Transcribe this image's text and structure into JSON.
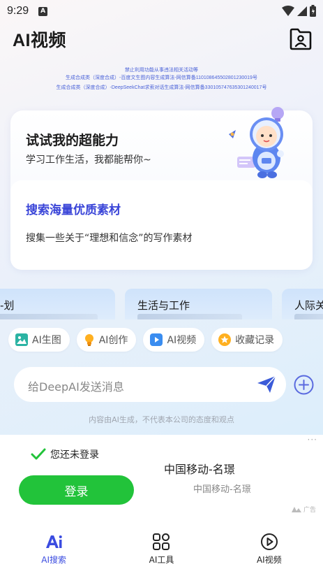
{
  "status_bar": {
    "time": "9:29",
    "notification_badge": "A"
  },
  "header": {
    "title": "AI视频"
  },
  "notices": [
    "禁止利用功能从事违法相关活动等",
    "生成合成类（深度合成）-百度文生图内容生成算法-网信算备110108645502801230019号",
    "生成合成类（深度合成）-DeepSeekChat求索对话生成算法-网信算备330105747635301240017号"
  ],
  "hero": {
    "title": "试试我的超能力",
    "subtitle": "学习工作生活，我都能帮你~"
  },
  "suggestion": {
    "title": "搜索海量优质素材",
    "text": "搜集一些关于“理想和信念”的写作素材"
  },
  "topics": [
    {
      "label": "-划"
    },
    {
      "label": "生活与工作"
    },
    {
      "label": "人际关"
    }
  ],
  "tools": [
    {
      "label": "AI生图",
      "icon": "image-icon"
    },
    {
      "label": "AI创作",
      "icon": "bulb-icon"
    },
    {
      "label": "AI视频",
      "icon": "play-icon"
    },
    {
      "label": "收藏记录",
      "icon": "star-icon"
    }
  ],
  "input": {
    "placeholder": "给DeepAI发送消息"
  },
  "disclaimer": "内容由AI生成，不代表本公司的态度和观点",
  "ad": {
    "more": "···",
    "login_status": "您还未登录",
    "login_button": "登录",
    "carrier": "中国移动-名璟",
    "carrier_sub": "中国移动-名璟",
    "ad_label": "广告"
  },
  "tab_bar": [
    {
      "label": "AI搜索",
      "icon": "ai-logo-icon",
      "active": true
    },
    {
      "label": "AI工具",
      "icon": "grid-icon",
      "active": false
    },
    {
      "label": "AI视频",
      "icon": "video-play-icon",
      "active": false
    }
  ],
  "colors": {
    "accent": "#3b4ce0",
    "login_green": "#22c33a",
    "notice_blue": "#4a62d8",
    "send_blue": "#3b5bd8"
  }
}
